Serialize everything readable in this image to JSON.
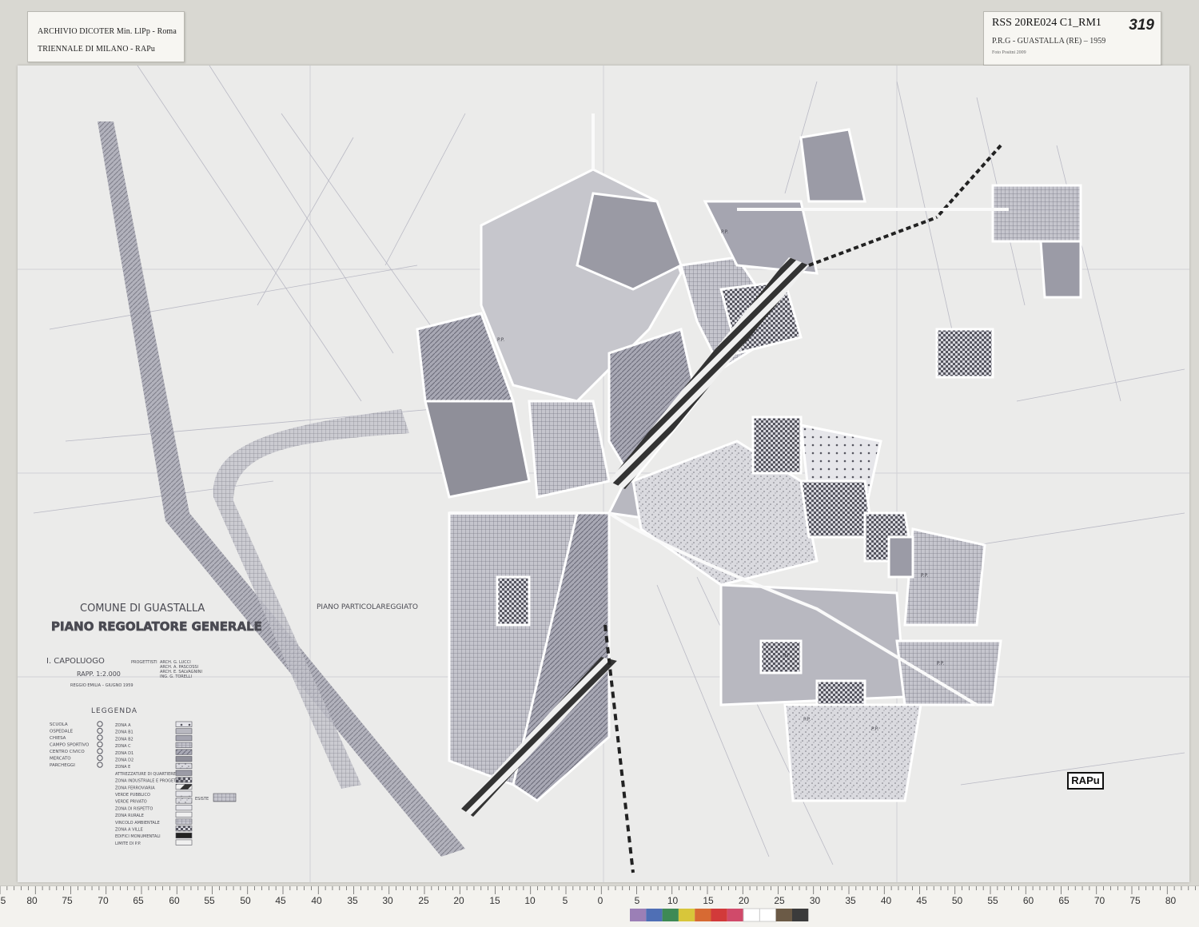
{
  "archive_label": {
    "line1": "ARCHIVIO DICOTER Min. LlPp - Roma",
    "line2": "TRIENNALE DI MILANO - RAPu"
  },
  "catalog_label": {
    "code": "RSS 20RE024 C1_RM1",
    "number": "319",
    "title": "P.R.G  - GUASTALLA (RE) – 1959",
    "photo_credit": "Foto Positni 2009"
  },
  "map": {
    "municipality": "COMUNE DI GUASTALLA",
    "plan_title": "PIANO REGOLATORE GENERALE",
    "section": "I. CAPOLUOGO",
    "scale": "RAPP. 1:2.000",
    "place_date": "REGGIO EMILIA – GIUGNO 1959",
    "designers_label": "PROGETTISTI",
    "designers": [
      "ARCH. G. LUCCI",
      "ARCH. A. PASCOSSI",
      "ARCH. E. SALVAGNINI",
      "ING. G. TORELLI"
    ],
    "plan_annotation": "PIANO PARTICOLAREGGIATO",
    "zone_markers": [
      "P.P.",
      "P.P.",
      "P.P.",
      "P.P.",
      "P.P.",
      "P.P.",
      "P.P."
    ],
    "stamp": "RAPu"
  },
  "legend": {
    "title": "LEGGENDA",
    "symbols": [
      {
        "label": "SCUOLA",
        "icon": "school-symbol"
      },
      {
        "label": "OSPEDALE",
        "icon": "hospital-symbol"
      },
      {
        "label": "CHIESA",
        "icon": "church-symbol"
      },
      {
        "label": "CAMPO SPORTIVO",
        "icon": "sports-field-symbol"
      },
      {
        "label": "CENTRO CIVICO",
        "icon": "civic-center-symbol"
      },
      {
        "label": "MERCATO",
        "icon": "market-symbol"
      },
      {
        "label": "PARCHEGGI",
        "icon": "parking-symbol"
      }
    ],
    "zones": [
      "ZONA A",
      "ZONA B1",
      "ZONA B2",
      "ZONA C",
      "ZONA D1",
      "ZONA D2",
      "ZONA E",
      "ATTREZZATURE DI QUARTIERE",
      "ZONA INDUSTRIALE E PROGETTATA",
      "ZONA FERROVIARIA",
      "VERDE PUBBLICO",
      "VERDE PRIVATO",
      "ZONA DI RISPETTO",
      "ZONA RURALE",
      "VINCOLO AMBIENTALE",
      "ZONA A VILLE",
      "EDIFICI MONUMENTALI",
      "LIMITE DI P.P."
    ],
    "extra_note": "ESISTE"
  },
  "ruler": {
    "left_ticks": [
      "5",
      "80",
      "75",
      "70",
      "65",
      "60",
      "55",
      "50",
      "45",
      "40",
      "35",
      "30",
      "25",
      "20",
      "15",
      "10",
      "5",
      "0"
    ],
    "right_ticks": [
      "5",
      "10",
      "15",
      "20",
      "25",
      "30",
      "35",
      "40",
      "45",
      "50",
      "55",
      "60",
      "65",
      "70",
      "75",
      "80"
    ],
    "color_patches": [
      "#9b7fb6",
      "#4f6fb5",
      "#3e8a55",
      "#d8c63a",
      "#d76a33",
      "#d23a3a",
      "#d04a6a",
      "#ffffff",
      "#ffffff",
      "#6b5a46",
      "#3b3b3b"
    ]
  }
}
